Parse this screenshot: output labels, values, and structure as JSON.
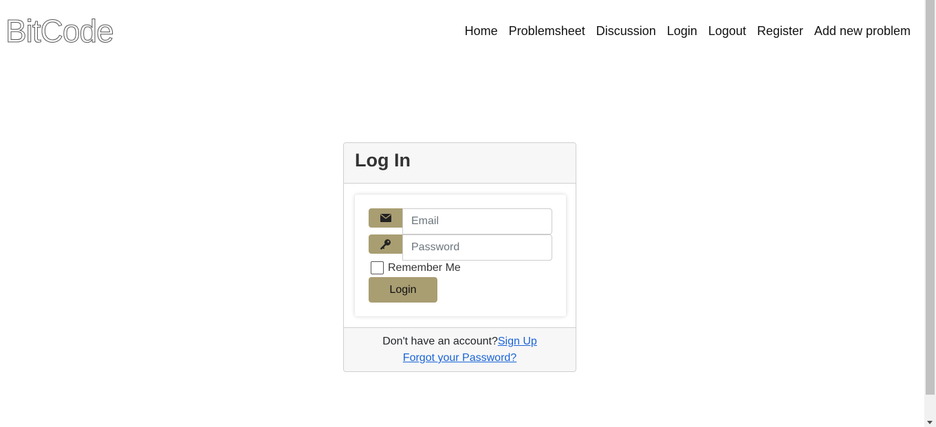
{
  "brand": {
    "name": "BitCode"
  },
  "nav": {
    "items": [
      {
        "label": "Home"
      },
      {
        "label": "Problemsheet"
      },
      {
        "label": "Discussion"
      },
      {
        "label": "Login"
      },
      {
        "label": "Logout"
      },
      {
        "label": "Register"
      },
      {
        "label": "Add new problem"
      }
    ]
  },
  "login_card": {
    "title": "Log In",
    "email": {
      "value": "",
      "placeholder": "Email",
      "icon": "envelope-icon"
    },
    "password": {
      "value": "",
      "placeholder": "Password",
      "icon": "key-icon"
    },
    "remember_label": "Remember Me",
    "remember_checked": false,
    "submit_label": "Login",
    "footer": {
      "signup_prompt": "Don't have an account?",
      "signup_link": "Sign Up",
      "forgot_link": "Forgot your Password?"
    }
  },
  "colors": {
    "accent": "#a99d72",
    "link": "#1a63d8",
    "card_header_bg": "#f7f7f7"
  }
}
